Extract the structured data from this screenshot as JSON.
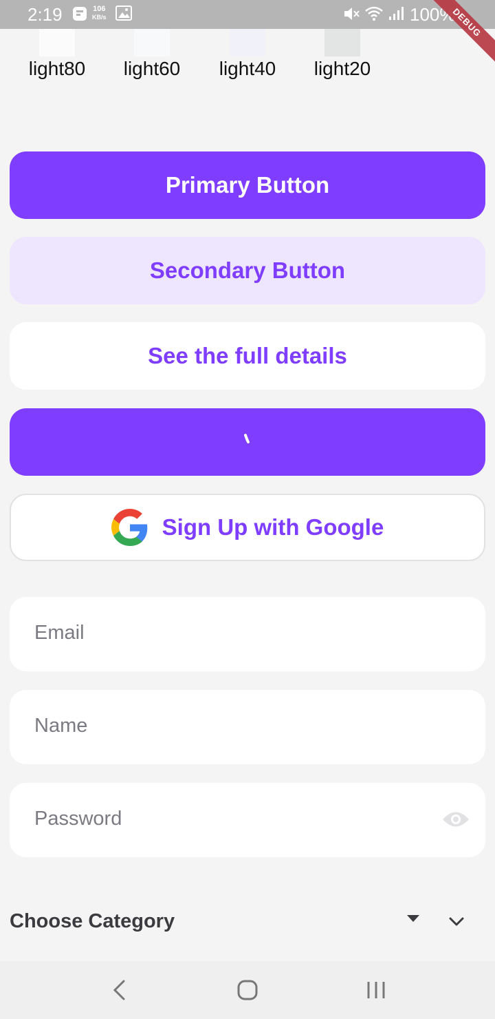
{
  "status_bar": {
    "time": "2:19",
    "net_speed_value": "106",
    "net_speed_unit": "KB/s",
    "battery": "100%",
    "debug_banner": "DEBUG"
  },
  "swatches": [
    {
      "label": "light80",
      "color": "#fbfbfb"
    },
    {
      "label": "light60",
      "color": "#f7f9fa"
    },
    {
      "label": "light40",
      "color": "#f1f1fa"
    },
    {
      "label": "light20",
      "color": "#e3e5e5"
    }
  ],
  "buttons": {
    "primary": "Primary Button",
    "secondary": "Secondary Button",
    "link": "See the full details",
    "google": "Sign Up with Google"
  },
  "fields": {
    "email_placeholder": "Email",
    "name_placeholder": "Name",
    "password_placeholder": "Password"
  },
  "dropdown": {
    "label": "Choose Category"
  },
  "colors": {
    "accent": "#7f3dff",
    "accent_light": "#eee5ff",
    "background": "#f4f4f4"
  },
  "icons": {
    "google": "google-g-icon",
    "password_toggle": "eye-icon",
    "dropdown": "dropdown-arrow-icon",
    "expand": "chevron-down-icon"
  }
}
